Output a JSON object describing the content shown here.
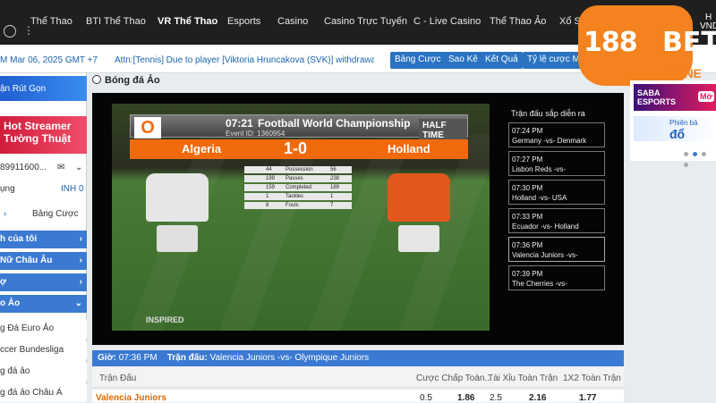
{
  "nav": {
    "items": [
      "Thể Thao",
      "BTI Thể Thao",
      "VR Thể Thao",
      "Esports",
      "Casino",
      "Casino Trực Tuyến",
      "C - Live Casino",
      "Thể Thao Ảo",
      "Xổ S"
    ],
    "active_index": 2,
    "hi_text": "H",
    "currency": "VND/("
  },
  "logo": {
    "text_a": "188",
    "text_b": "BET",
    "zone": "ZONE"
  },
  "toolbar": {
    "date": "M Mar 06, 2025 GMT +7",
    "ticker": "Attn:[Tennis] Due to player [Viktoria Hruncakova (SVK)] withdrawal, [ITF -",
    "buttons": [
      "Bảng Cược",
      "Sao Kê",
      "Kết Quả",
      "Tỷ lệ cược MA"
    ]
  },
  "sidebar": {
    "promo1": "ận Rút Gọn",
    "promo2_line1": "Hot Streamer",
    "promo2_line2": "Tường Thuật",
    "account_id": "89911600...",
    "balance_label": "ụng",
    "balance_value": "INH 0",
    "tabs": [
      "",
      "Bảng Cược"
    ],
    "rows": [
      {
        "label": "h của tôi",
        "style": "blue"
      },
      {
        "label": "Nữ Châu Âu",
        "style": "blue"
      },
      {
        "label": "ợ",
        "style": "blue"
      },
      {
        "label": "o Ảo",
        "style": "blue"
      },
      {
        "label": "g Đá Euro Ảo",
        "style": "plain"
      },
      {
        "label": "ccer Bundesliga",
        "style": "plain"
      },
      {
        "label": "g đá ảo",
        "style": "plain"
      },
      {
        "label": "g đá ảo Châu Á",
        "style": "plain"
      }
    ]
  },
  "main": {
    "title": "Bóng đá Ảo",
    "video": {
      "time": "07:21",
      "competition": "Football World Championship",
      "event_id": "Event ID: 1360954",
      "status": "HALF TIME",
      "team_a": "Algeria",
      "score": "1-0",
      "team_b": "Holland",
      "stats": [
        {
          "a": "44",
          "label": "Possession",
          "b": "56"
        },
        {
          "a": "199",
          "label": "Passes",
          "b": "238"
        },
        {
          "a": "159",
          "label": "Completed",
          "b": "189"
        },
        {
          "a": "1",
          "label": "Tackles",
          "b": "1"
        },
        {
          "a": "8",
          "label": "Fouls",
          "b": "7"
        }
      ],
      "brand": "INSPIRED",
      "colors": {
        "team_a": "#e6e6e6",
        "team_b": "#e2581c",
        "bar": "#f06a0c"
      }
    },
    "upcoming_title": "Trận đấu sắp diễn ra",
    "upcoming": [
      {
        "time": "07:24 PM",
        "teams": "Germany -vs- Denmark"
      },
      {
        "time": "07:27 PM",
        "teams": "Lisbon Reds -vs-"
      },
      {
        "time": "07:30 PM",
        "teams": "Holland -vs- USA"
      },
      {
        "time": "07:33 PM",
        "teams": "Ecuador -vs- Holland"
      },
      {
        "time": "07:36 PM",
        "teams": "Valencia Juniors -vs-"
      },
      {
        "time": "07:39 PM",
        "teams": "The Cherries -vs-"
      }
    ],
    "selected_upcoming_index": 4,
    "bottom": {
      "time_label": "Giờ:",
      "time_value": "07:36 PM",
      "match_label": "Trận đấu:",
      "match_value": "Valencia Juniors -vs- Olympique Juniors"
    },
    "table": {
      "headers": [
        "Trận Đấu",
        "Cược Chấp Toàn...",
        "Tài Xỉu Toàn Trận",
        "1X2 Toàn Trận"
      ],
      "row": {
        "team": "Valencia Juniors",
        "hdp": "0.5",
        "hdp_odds": "1.86",
        "ou": "2.5",
        "ou_odds": "2.16",
        "x12": "1.77"
      }
    }
  },
  "right_panel": {
    "saba_line1": "SABA",
    "saba_line2": "ESPORTS",
    "saba_tag": "Mớ",
    "phien_line1": "Phiên bả",
    "phien_line2": "đổ",
    "active_dot": 1
  }
}
